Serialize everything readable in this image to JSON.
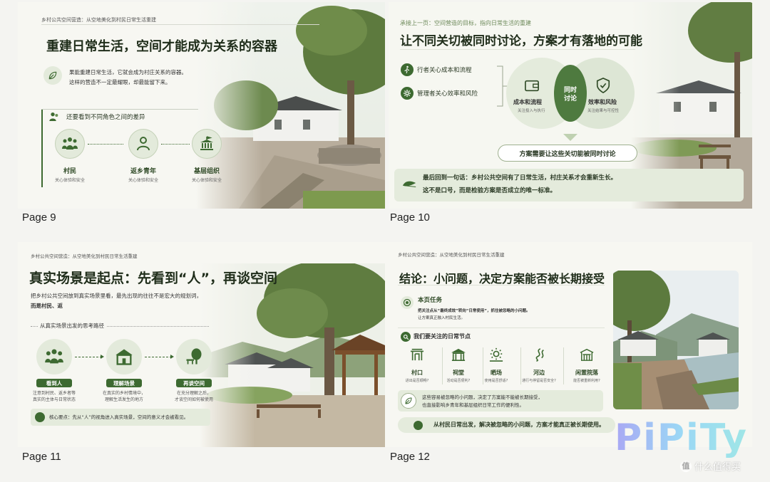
{
  "colors": {
    "accent": "#3d6a31",
    "light_green": "#e4eddd",
    "background": "#f4f4f1"
  },
  "pages": {
    "p9": {
      "label": "Page 9",
      "kicker": "乡村公共空间营造：从空地美化到村民日常生活重建",
      "title": "重建日常生活，空间才能成为关系的容器",
      "intro_1": "果能重建日常生活，它就会成为村庄关系的容器。",
      "intro_2": "这样的营造不一定最耀眼，却最能留下来。",
      "section": "还要看到不同角色之间的差异",
      "roles": [
        {
          "name": "村民",
          "desc": "关心体验和安全",
          "icon": "group-icon"
        },
        {
          "name": "返乡青年",
          "desc": "关心体验和安全",
          "icon": "person-icon"
        },
        {
          "name": "基层组织",
          "desc": "关心体验和安全",
          "icon": "building-icon"
        }
      ]
    },
    "p10": {
      "label": "Page 10",
      "kicker": "承接上一页：空间营造的目标，指向日常生活的重建",
      "title": "让不同关切被同时讨论，方案才有落地的可能",
      "left_items": [
        "行者关心成本和流程",
        "管理者关心效率和风险"
      ],
      "venn_left_title": "成本和流程",
      "venn_left_sub": "关注投入与执行",
      "venn_center_1": "同时",
      "venn_center_2": "讨论",
      "venn_right_title": "效率和风险",
      "venn_right_sub": "关注结果与可控性",
      "conclusion": "方案需要让这些关切能被同时讨论",
      "bottom_1": "最后回到一句话：乡村公共空间有了日常生活，村庄关系才会重新生长。",
      "bottom_2": "这不是口号，而是检验方案是否成立的唯一标准。"
    },
    "p11": {
      "label": "Page 11",
      "kicker": "乡村公共空间营造：从空地美化到村民日常生活重建",
      "title": "真实场景是起点：先看到“人”，再谈空间",
      "intro_1": "把乡村公共空间放到真实场景里看，最先出现的往往不是宏大的规划词，",
      "intro_2": "而是村民、返",
      "path_label": "从真实场景出发的思考路径",
      "steps": [
        {
          "name": "看到人",
          "desc_1": "注意到村民、返乡者等",
          "desc_2": "真实的主体与日常状态",
          "icon": "group-icon"
        },
        {
          "name": "理解场景",
          "desc_1": "在真实的乡村情境中，",
          "desc_2": "理解生活发生的地方",
          "icon": "house-icon"
        },
        {
          "name": "再谈空间",
          "desc_1": "在充分理解之后，",
          "desc_2": "才谈空间如何被使用",
          "icon": "tree-icon"
        }
      ],
      "core": "核心要点：先从“人”的视角进入真实场景，空间的意义才会被看见。"
    },
    "p12": {
      "label": "Page 12",
      "kicker": "乡村公共空间营造：从空地美化到村民日常生活重建",
      "title": "结论：小问题，决定方案能否被长期接受",
      "task_title": "本页任务",
      "task_1": "把关注点从“最终成效”转向“日常使用”，抓住被忽略的小问题。",
      "task_2": "让方案真正融入村民生活。",
      "nodes_title": "我们要关注的日常节点",
      "nodes": [
        {
          "name": "村口",
          "desc": "进出是否顺畅?",
          "icon": "gate-icon"
        },
        {
          "name": "祠堂",
          "desc": "活动是否便利?",
          "icon": "temple-icon"
        },
        {
          "name": "晒场",
          "desc": "使用是否舒适?",
          "icon": "sun-icon"
        },
        {
          "name": "河边",
          "desc": "通行与停留是否安全?",
          "icon": "river-icon"
        },
        {
          "name": "闲置院落",
          "desc": "能否被重新利用?",
          "icon": "courtyard-icon"
        }
      ],
      "info_1": "这些容易被忽略的小问题，决定了方案能不能被长期接受，",
      "info_2": "也直接影响乡青年和基层组织日常工作的便利性。",
      "bottom": "从村民日常出发，解决被忽略的小问题，方案才能真正被长期使用。"
    }
  },
  "watermark": {
    "brand": "PiPiTy",
    "site": "什么值得买"
  }
}
